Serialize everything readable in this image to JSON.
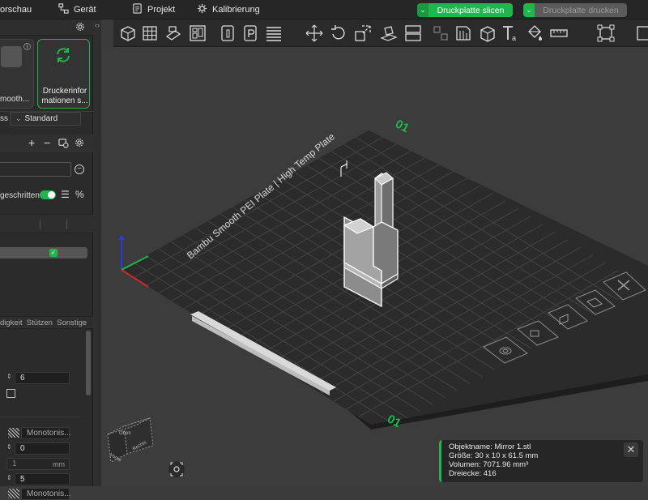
{
  "topbar": {
    "preview_label": "orschau",
    "device_label": "Gerät",
    "project_label": "Projekt",
    "calibration_label": "Kalibrierung",
    "slice_label": "Druckplatte slicen",
    "print_label": "Druckplatte drucken",
    "accent": "#1fb64d"
  },
  "sidebar": {
    "plate_label": "mooth...",
    "printer_info_label": "Druckerinfor mationen s...",
    "process_prefix": "ss",
    "process_value": "Standard",
    "advanced_label": "geschritten",
    "tabs_label": "digkeit  Stützen  Sonstige",
    "field_wall_loops": "6",
    "pattern_top": "Monotonis...",
    "field_zero": "0",
    "field_mm_value": "1",
    "field_mm_unit": "mm",
    "field_five": "5",
    "pattern_bottom": "Monotonis..."
  },
  "plate": {
    "text": "Bambu Smooth PEI Plate | High Temp Plate",
    "id_top": "01",
    "id_bottom": "01"
  },
  "viewcube": {
    "face_top": "Oben",
    "face_left": "Vorne",
    "face_right": "Rechts"
  },
  "info": {
    "object_name": "Objektname: Mirror 1.stl",
    "size": "Größe: 30 x 10 x 61.5 mm",
    "volume": "Volumen: 7071.96 mm³",
    "triangles": "Dreiecke: 416"
  }
}
